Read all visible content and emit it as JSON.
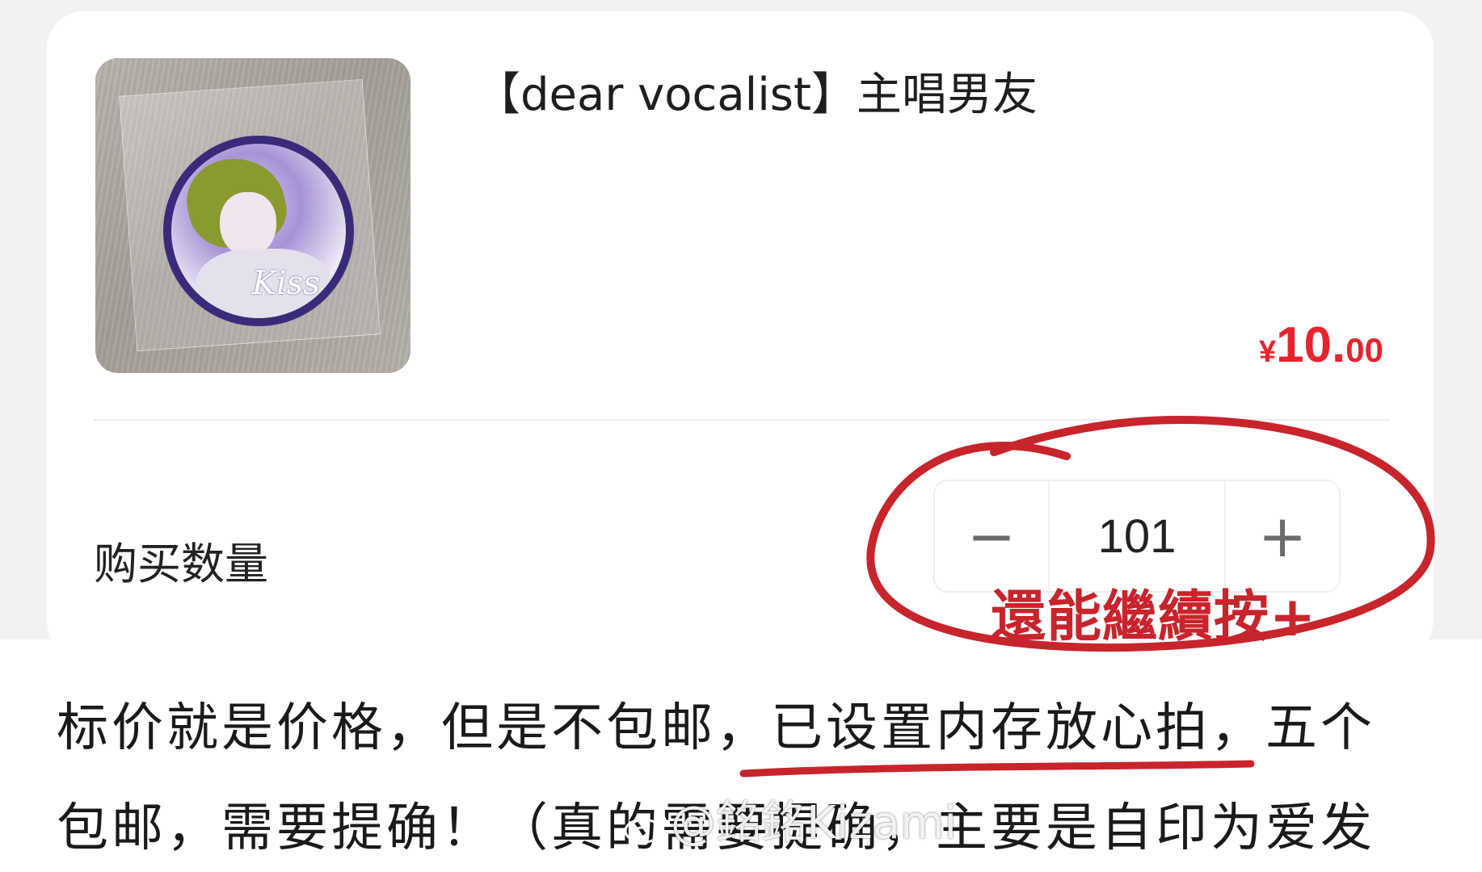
{
  "product": {
    "title": "【dear vocalist】主唱男友",
    "price_currency": "¥",
    "price_integer": "10.",
    "price_decimal": "00",
    "price_color": "#e8232e",
    "image_signature": "Kiss"
  },
  "quantity": {
    "label": "购买数量",
    "minus": "−",
    "value": "101",
    "plus": "+"
  },
  "annotation": {
    "text": "還能繼續按+",
    "color": "#c8242c"
  },
  "caption": {
    "line1_before": "标价就是价格，但是不包邮，",
    "line1_underlined": "已设置内存放心拍，",
    "line1_after": "五个",
    "line2_before": "包邮，需要提确！（真的需要提确，",
    "line2_after": "主要是自印为爱发"
  },
  "watermark": {
    "text": "@銘銘Kizami",
    "icon": "weibo-logo-icon"
  }
}
